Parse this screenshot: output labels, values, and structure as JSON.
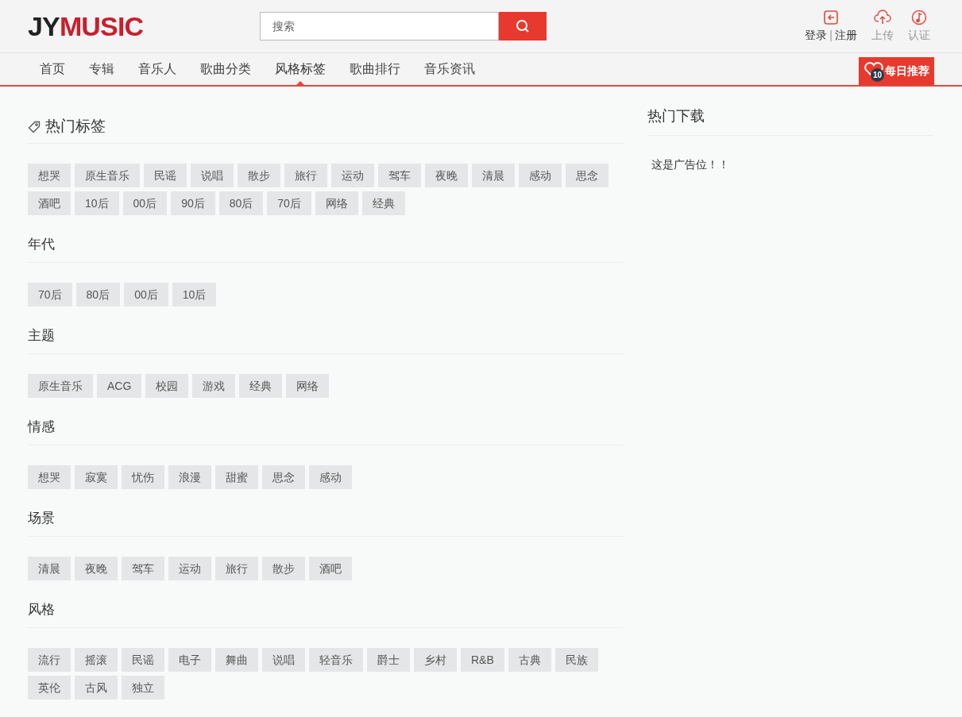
{
  "logo": {
    "dark": "JY",
    "red": "MUSIC"
  },
  "search": {
    "placeholder": "搜索"
  },
  "user_actions": {
    "login": "登录",
    "separator": "|",
    "register": "注册",
    "upload": "上传",
    "verify": "认证"
  },
  "nav": [
    {
      "label": "首页",
      "selected": false
    },
    {
      "label": "专辑",
      "selected": false
    },
    {
      "label": "音乐人",
      "selected": false
    },
    {
      "label": "歌曲分类",
      "selected": false
    },
    {
      "label": "风格标签",
      "selected": true
    },
    {
      "label": "歌曲排行",
      "selected": false
    },
    {
      "label": "音乐资讯",
      "selected": false
    }
  ],
  "daily": {
    "label": "每日推荐",
    "count": "10"
  },
  "hot_tags": {
    "title": "热门标签",
    "tags": [
      "想哭",
      "原生音乐",
      "民谣",
      "说唱",
      "散步",
      "旅行",
      "运动",
      "驾车",
      "夜晚",
      "清晨",
      "感动",
      "思念",
      "酒吧",
      "10后",
      "00后",
      "90后",
      "80后",
      "70后",
      "网络",
      "经典"
    ]
  },
  "sections": [
    {
      "title": "年代",
      "tags": [
        "70后",
        "80后",
        "00后",
        "10后"
      ]
    },
    {
      "title": "主题",
      "tags": [
        "原生音乐",
        "ACG",
        "校园",
        "游戏",
        "经典",
        "网络"
      ]
    },
    {
      "title": "情感",
      "tags": [
        "想哭",
        "寂寞",
        "忧伤",
        "浪漫",
        "甜蜜",
        "思念",
        "感动"
      ]
    },
    {
      "title": "场景",
      "tags": [
        "清晨",
        "夜晚",
        "驾车",
        "运动",
        "旅行",
        "散步",
        "酒吧"
      ]
    },
    {
      "title": "风格",
      "tags": [
        "流行",
        "摇滚",
        "民谣",
        "电子",
        "舞曲",
        "说唱",
        "轻音乐",
        "爵士",
        "乡村",
        "R&B",
        "古典",
        "民族",
        "英伦",
        "古风",
        "独立"
      ]
    }
  ],
  "sidebar": {
    "title": "热门下载",
    "ad": "这是广告位！！"
  }
}
